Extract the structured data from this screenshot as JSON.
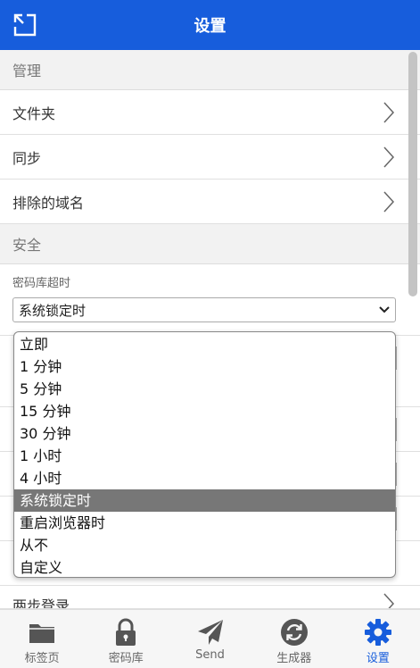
{
  "header": {
    "title": "设置"
  },
  "sections": {
    "manage": {
      "title": "管理",
      "items": [
        {
          "label": "文件夹"
        },
        {
          "label": "同步"
        },
        {
          "label": "排除的域名"
        }
      ]
    },
    "security": {
      "title": "安全",
      "vault_timeout_label": "密码库超时",
      "vault_timeout_value": "系统锁定时",
      "partial_row_label": "两步登录"
    }
  },
  "dropdown": {
    "options": [
      "立即",
      "1 分钟",
      "5 分钟",
      "15 分钟",
      "30 分钟",
      "1 小时",
      "4 小时",
      "系统锁定时",
      "重启浏览器时",
      "从不",
      "自定义"
    ],
    "selected_index": 7
  },
  "tabs": [
    {
      "label": "标签页",
      "icon": "folder-icon",
      "active": false
    },
    {
      "label": "密码库",
      "icon": "lock-icon",
      "active": false
    },
    {
      "label": "Send",
      "icon": "paper-plane-icon",
      "active": false
    },
    {
      "label": "生成器",
      "icon": "refresh-icon",
      "active": false
    },
    {
      "label": "设置",
      "icon": "gear-icon",
      "active": true
    }
  ],
  "colors": {
    "brand": "#175ddc",
    "selected_option": "#777777",
    "inactive_icon": "#555555"
  }
}
